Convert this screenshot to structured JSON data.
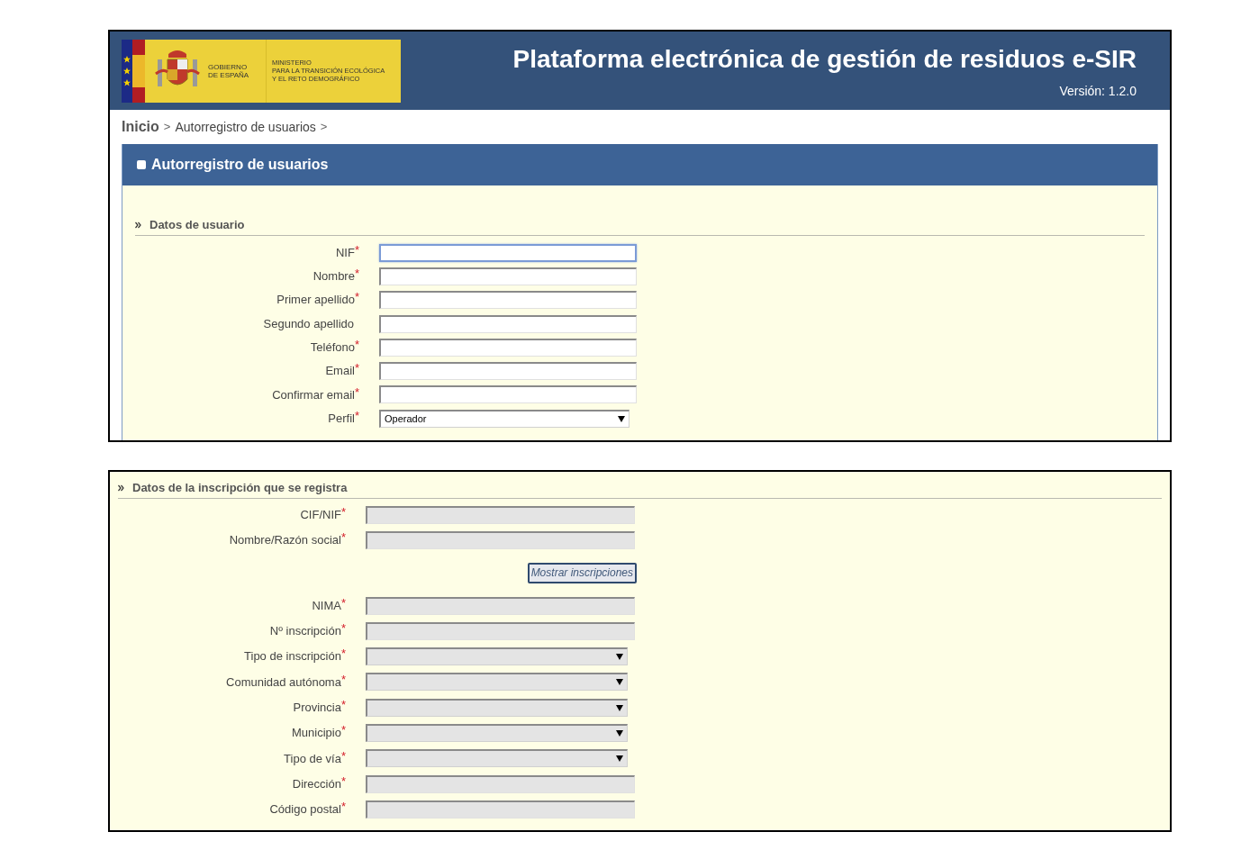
{
  "header": {
    "logo_left": [
      "GOBIERNO",
      "DE ESPAÑA"
    ],
    "logo_right": [
      "MINISTERIO",
      "PARA LA TRANSICIÓN ECOLÓGICA",
      "Y EL RETO DEMOGRÁFICO"
    ],
    "title": "Plataforma electrónica de gestión de residuos e-SIR",
    "version": "Versión: 1.2.0"
  },
  "breadcrumb": [
    {
      "label": "Inicio",
      "current": false
    },
    {
      "label": "Autorregistro de usuarios",
      "current": true
    }
  ],
  "breadcrumb_separator": ">",
  "required_mark": "*",
  "panel_title": "Autorregistro de usuarios",
  "user_section": {
    "title": "Datos de usuario",
    "fields": [
      {
        "label": "NIF",
        "required": true,
        "kind": "text",
        "focused": true,
        "disabled": false
      },
      {
        "label": "Nombre",
        "required": true,
        "kind": "text",
        "focused": false,
        "disabled": false
      },
      {
        "label": "Primer apellido",
        "required": true,
        "kind": "text",
        "focused": false,
        "disabled": false
      },
      {
        "label": "Segundo apellido",
        "required": false,
        "kind": "text",
        "focused": false,
        "disabled": false
      },
      {
        "label": "Teléfono",
        "required": true,
        "kind": "text",
        "focused": false,
        "disabled": false
      },
      {
        "label": "Email",
        "required": true,
        "kind": "text",
        "focused": false,
        "disabled": false
      },
      {
        "label": "Confirmar email",
        "required": true,
        "kind": "text",
        "focused": false,
        "disabled": false
      },
      {
        "label": "Perfil",
        "required": true,
        "kind": "select",
        "value": "Operador",
        "focused": false,
        "disabled": false
      }
    ]
  },
  "inscription_section": {
    "title": "Datos de la inscripción que se registra",
    "fields": [
      {
        "label": "CIF/NIF",
        "required": true,
        "kind": "text",
        "focused": false,
        "disabled": true
      },
      {
        "label": "Nombre/Razón social",
        "required": true,
        "kind": "text",
        "focused": false,
        "disabled": true
      },
      {
        "label": "Mostrar inscripciones",
        "kind": "button"
      },
      {
        "label": "NIMA",
        "required": true,
        "kind": "text",
        "focused": false,
        "disabled": true
      },
      {
        "label": "Nº inscripción",
        "required": true,
        "kind": "text",
        "focused": false,
        "disabled": true
      },
      {
        "label": "Tipo de inscripción",
        "required": true,
        "kind": "select",
        "focused": false,
        "disabled": true
      },
      {
        "label": "Comunidad autónoma",
        "required": true,
        "kind": "select",
        "focused": false,
        "disabled": true
      },
      {
        "label": "Provincia",
        "required": true,
        "kind": "select",
        "focused": false,
        "disabled": true
      },
      {
        "label": "Municipio",
        "required": true,
        "kind": "select",
        "focused": false,
        "disabled": true
      },
      {
        "label": "Tipo de vía",
        "required": true,
        "kind": "select",
        "focused": false,
        "disabled": true
      },
      {
        "label": "Dirección",
        "required": true,
        "kind": "text",
        "focused": false,
        "disabled": true
      },
      {
        "label": "Código postal",
        "required": true,
        "kind": "text",
        "focused": false,
        "disabled": true
      }
    ]
  }
}
